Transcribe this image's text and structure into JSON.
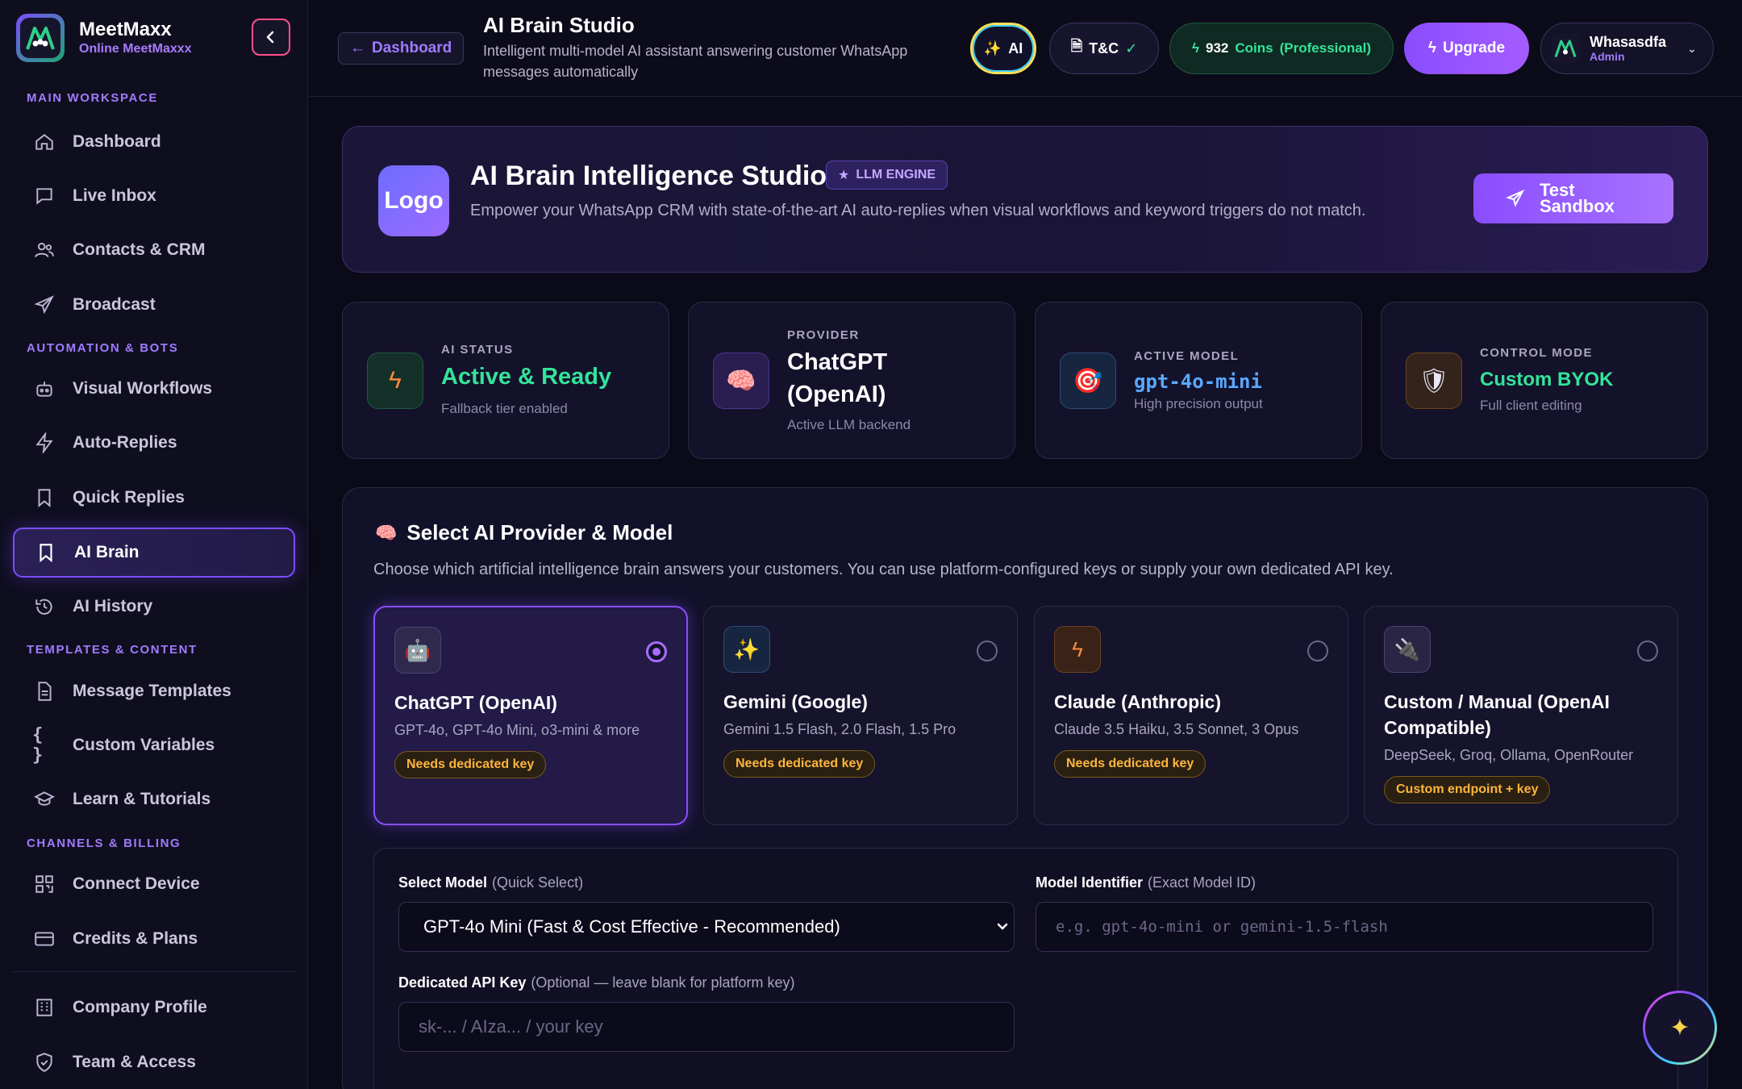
{
  "brand": {
    "name": "MeetMaxx",
    "subtitle": "Online MeetMaxxx"
  },
  "sidebar": {
    "sections": [
      "MAIN WORKSPACE",
      "AUTOMATION & BOTS",
      "TEMPLATES & CONTENT",
      "CHANNELS & BILLING"
    ],
    "items": [
      {
        "label": "Dashboard",
        "icon": "home-icon"
      },
      {
        "label": "Live Inbox",
        "icon": "chat-icon"
      },
      {
        "label": "Contacts & CRM",
        "icon": "users-icon"
      },
      {
        "label": "Broadcast",
        "icon": "send-icon"
      },
      {
        "label": "Visual Workflows",
        "icon": "bot-icon"
      },
      {
        "label": "Auto-Replies",
        "icon": "bolt-icon"
      },
      {
        "label": "Quick Replies",
        "icon": "bookmark-icon"
      },
      {
        "label": "AI Brain",
        "icon": "bookmark-icon"
      },
      {
        "label": "AI History",
        "icon": "history-icon"
      },
      {
        "label": "Message Templates",
        "icon": "document-icon"
      },
      {
        "label": "Custom Variables",
        "icon": "braces-icon"
      },
      {
        "label": "Learn & Tutorials",
        "icon": "graduation-cap-icon"
      },
      {
        "label": "Connect Device",
        "icon": "qr-code-icon"
      },
      {
        "label": "Credits & Plans",
        "icon": "credit-card-icon"
      },
      {
        "label": "Company Profile",
        "icon": "building-icon"
      },
      {
        "label": "Team & Access",
        "icon": "shield-icon"
      }
    ]
  },
  "topbar": {
    "back_label": "Dashboard",
    "title": "AI Brain Studio",
    "subtitle": "Intelligent multi-model AI assistant answering customer WhatsApp messages automatically",
    "ai_label": "AI",
    "tc_label": "T&C",
    "tc_check": "✓",
    "coins_amount": "932",
    "coins_word": "Coins",
    "coins_plan": "(Professional)",
    "upgrade_label": "Upgrade",
    "user_name": "Whasasdfa",
    "user_role": "Admin"
  },
  "hero": {
    "logo_text": "Logo",
    "title": "AI Brain Intelligence Studio",
    "badge": "LLM ENGINE",
    "description": "Empower your WhatsApp CRM with state-of-the-art AI auto-replies when visual workflows and keyword triggers do not match.",
    "button_line1": "Test",
    "button_line2": "Sandbox"
  },
  "stats": [
    {
      "label": "AI STATUS",
      "value": "Active & Ready",
      "sub": "Fallback tier enabled",
      "icon": "bolt-icon",
      "color": "#34e39a"
    },
    {
      "label": "PROVIDER",
      "value_line1": "ChatGPT",
      "value_line2": "(OpenAI)",
      "sub": "Active LLM backend",
      "icon": "brain-icon",
      "color": "#ffffff"
    },
    {
      "label": "ACTIVE MODEL",
      "value": "gpt-4o-mini",
      "sub": "High precision output",
      "icon": "target-icon",
      "color": "#5aa8ff"
    },
    {
      "label": "CONTROL MODE",
      "value": "Custom BYOK",
      "sub": "Full client editing",
      "icon": "shield-icon",
      "color": "#34e39a"
    }
  ],
  "provider_panel": {
    "title": "Select AI Provider & Model",
    "description": "Choose which artificial intelligence brain answers your customers. You can use platform-configured keys or supply your own dedicated API key.",
    "providers": [
      {
        "name": "ChatGPT (OpenAI)",
        "models": "GPT-4o, GPT-4o Mini, o3-mini & more",
        "tag": "Needs dedicated key",
        "selected": true,
        "icon": "robot-icon"
      },
      {
        "name": "Gemini (Google)",
        "models": "Gemini 1.5 Flash, 2.0 Flash, 1.5 Pro",
        "tag": "Needs dedicated key",
        "selected": false,
        "icon": "sparkles-icon"
      },
      {
        "name": "Claude (Anthropic)",
        "models": "Claude 3.5 Haiku, 3.5 Sonnet, 3 Opus",
        "tag": "Needs dedicated key",
        "selected": false,
        "icon": "bolt-icon"
      },
      {
        "name": "Custom / Manual (OpenAI Compatible)",
        "models": "DeepSeek, Groq, Ollama, OpenRouter",
        "tag": "Custom endpoint + key",
        "selected": false,
        "icon": "plug-icon"
      }
    ]
  },
  "config": {
    "select_model_label": "Select Model",
    "select_model_hint": "(Quick Select)",
    "select_model_value": "GPT-4o Mini (Fast & Cost Effective - Recommended)",
    "model_id_label": "Model Identifier",
    "model_id_hint": "(Exact Model ID)",
    "model_id_placeholder": "e.g. gpt-4o-mini or gemini-1.5-flash",
    "api_key_label": "Dedicated API Key",
    "api_key_hint": "(Optional — leave blank for platform key)",
    "api_key_placeholder": "sk-... / AIza... / your key"
  }
}
